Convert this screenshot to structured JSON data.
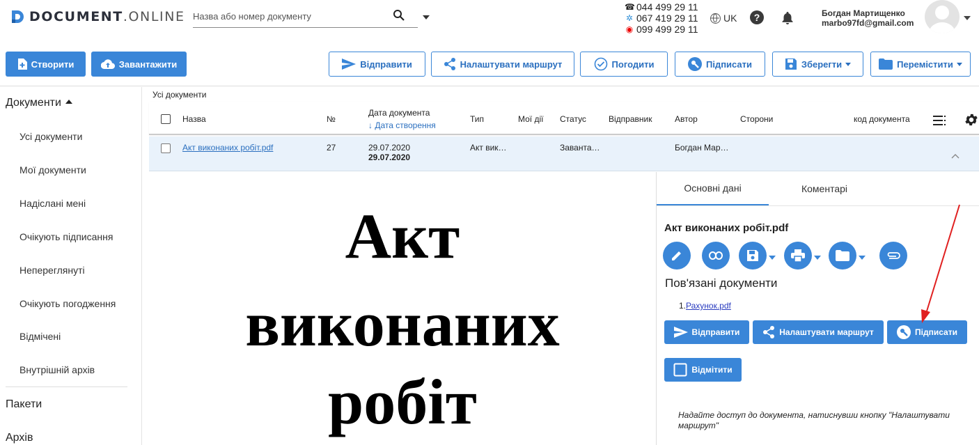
{
  "header": {
    "logo_bold": "DOCUMENT",
    "logo_thin": ".ONLINE",
    "search_placeholder": "Назва або номер документу",
    "phones": [
      "044 499 29 11",
      "067 419 29 11",
      "099 499 29 11"
    ],
    "language": "UK",
    "user_name": "Богдан Мартищенко",
    "user_email": "marbo97fd@gmail.com"
  },
  "toolbar": {
    "create": "Створити",
    "upload": "Завантажити",
    "send": "Відправити",
    "route": "Налаштувати маршрут",
    "approve": "Погодити",
    "sign": "Підписати",
    "save": "Зберегти",
    "move": "Перемістити"
  },
  "sidebar": {
    "documents": "Документи",
    "items": [
      "Усі документи",
      "Мої документи",
      "Надіслані мені",
      "Очікують підписання",
      "Непереглянуті",
      "Очікують погодження",
      "Відмічені",
      "Внутрішній архів"
    ],
    "packages": "Пакети",
    "archive": "Архів"
  },
  "table": {
    "breadcrumb": "Усі документи",
    "columns": {
      "name": "Назва",
      "number": "№",
      "doc_date": "Дата документа",
      "created_date": "↓ Дата створення",
      "type": "Тип",
      "my_actions": "Мої дії",
      "status": "Статус",
      "sender": "Відправник",
      "author": "Автор",
      "parties": "Сторони",
      "doc_code": "код документа"
    },
    "rows": [
      {
        "name": "Акт виконаних робіт.pdf",
        "number": "27",
        "doc_date": "29.07.2020",
        "created_date": "29.07.2020",
        "type": "Акт вик…",
        "status": "Заванта…",
        "author": "Богдан Мар…"
      }
    ]
  },
  "preview": {
    "lines": [
      "Акт",
      "виконаних",
      "робіт"
    ]
  },
  "panel": {
    "tab_main": "Основні дані",
    "tab_comments": "Коментарі",
    "title": "Акт виконаних робіт.pdf",
    "related_title": "Пов'язані документи",
    "related_prefix": "1.",
    "related_link": "Рахунок.pdf",
    "send": "Відправити",
    "route": "Налаштувати маршрут",
    "sign": "Підписати",
    "mark": "Відмітити",
    "hint": "Надайте доступ до документа, натиснувши кнопку \"Налаштувати маршрут\""
  },
  "colors": {
    "accent": "#3a86d8",
    "selected_row": "#e9f2fb",
    "annotation_arrow": "#e02020"
  }
}
